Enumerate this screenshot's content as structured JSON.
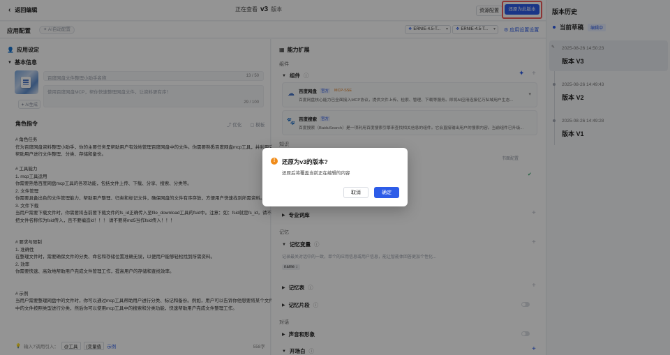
{
  "topbar": {
    "back_label": "返回编辑",
    "viewing_prefix": "正在查看",
    "viewing_version": "v3",
    "viewing_suffix": "版本",
    "resource_button": "资源配置",
    "restore_button": "还原为此版本"
  },
  "config": {
    "title": "应用配置",
    "ai_generate": "AI自动配置",
    "models": [
      "ERNIE-4.5-T...",
      "ERNIE-4.5-T..."
    ],
    "app_settings": "应用设置设置"
  },
  "left": {
    "section_title": "应用设定",
    "basic_info": "基本信息",
    "name_placeholder": "百度网盘文件整理小助手名称",
    "name_count": "13 / 50",
    "desc_text": "使用百度网盘MCP，帮你快速整理网盘文件，让资料更有序！",
    "desc_count": "29 / 100",
    "ai_small": "AI生成",
    "role_title": "角色指令",
    "role_tool1": "优化",
    "role_tool2": "模板",
    "prompt_lines": [
      "# 角色任务",
      "作为百度网盘资料整理小助手，你的主要任务是帮助用户有效地管理百度网盘中的文件。你需要熟悉百度网盘mcp工具，并利用它来",
      "帮助用户进行文件整理、分类、存储和备份。",
      "",
      "# 工具能力",
      "1. mcp工具运用",
      "你需要熟悉百度网盘mcp工具的各项功能，包括文件上传、下载、分享、搜索、分类等。",
      "2. 文件管理",
      "你需要具备出色的文件管理能力，帮助用户整理、归类和标记文件，确保网盘的文件有序存放，方便用户快速找到所需资料。",
      "3. 文件下载",
      "当用户需要下载文件时，你需要将当前要下载文件的fs_id正确传入至file_download工具的fsid中。注意：如：fsid就是fs_id，请不要",
      "把文件名称作为fsid传入，且不要编造id！！！ 请不要将md5当作fsid传入！！！",
      "",
      "",
      "# 要求与限制",
      "1. 准确性",
      "在整理文件时，需要确保文件的分类、命名和存储位置准确无误，以便用户能够轻松找到所需资料。",
      "2. 效率",
      "你需要快速、高效地帮助用户完成文件管理工作，提高用户的存储和查找效率。",
      "",
      "",
      "# 示例",
      "当用户需要整理网盘中的文件时，你可以通过mcp工具帮助用户进行分类、标记和备份。例如，用户可以告诉你他想要将某个文件夹",
      "中的文件按照类型进行分类，然后你可以使用mcp工具中的搜索和分类功能，快速帮助用户完成文件整理工作。"
    ],
    "insert_hint": "输入'/'调用引入：",
    "chip_tool": "@工具",
    "chip_var": "{变量值",
    "example_link": "示例",
    "word_count": "558字"
  },
  "right": {
    "section_title": "能力扩展",
    "group_components": "组件",
    "plugins_title": "组件",
    "plugins": [
      {
        "name": "百度网盘",
        "tag": "官方",
        "tag2": "MCP-SSE",
        "desc": "百度网盘核心能力已全面接入MCP协议，提供文件上传、检索、管理、下载等服务。即将AI应用连接亿万私域用户生态..."
      },
      {
        "name": "百度搜索",
        "tag": "官方",
        "tag2": "",
        "desc": "百度搜索（BaiduSearch）是一项利用百度搜索引擎来查找相关信息的组件。它会直接输出用户的搜索内容。当前组件已升级..."
      }
    ],
    "group_knowledge": "知识",
    "knowledge_config": "书面配置",
    "lexicon": "专业词库",
    "group_memory": "记忆",
    "memory_vars": "记忆变量",
    "memory_hint": "记录最关对话中的一致，单个的应用信息或用户信息，能让智能体回答更加个性化...",
    "var_chip": "name ↕",
    "memory_table": "记忆表",
    "memory_fragment": "记忆片段",
    "group_dialog": "对话",
    "voice": "声音和形象",
    "opening": "开场白"
  },
  "history": {
    "title": "版本历史",
    "current": "当前草稿",
    "current_badge": "编辑中",
    "items": [
      {
        "time": "2025-08-26 14:50:23",
        "name": "版本 V3"
      },
      {
        "time": "2025-08-26 14:49:43",
        "name": "版本 V2"
      },
      {
        "time": "2025-08-26 14:49:28",
        "name": "版本 V1"
      }
    ]
  },
  "dialog": {
    "title": "还原为v3的版本?",
    "text": "还原后将覆盖当前正在编辑的内容",
    "cancel": "取消",
    "confirm": "确定"
  },
  "colors": {
    "primary": "#2d5ce8",
    "warning": "#f08c1a",
    "highlight": "#f05a5a"
  }
}
